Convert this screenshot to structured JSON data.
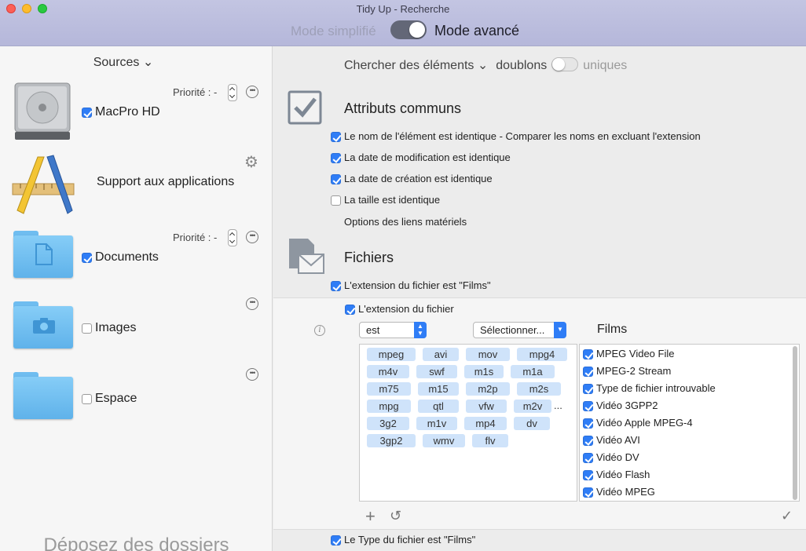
{
  "window": {
    "title": "Tidy Up - Recherche"
  },
  "mode": {
    "simple_label": "Mode simplifié",
    "advanced_label": "Mode avancé"
  },
  "sources": {
    "title": "Sources ⌄",
    "items": [
      {
        "label": "MacPro HD",
        "checked": true,
        "priority_label": "Priorité : -"
      },
      {
        "label": "Support aux applications"
      },
      {
        "label": "Documents",
        "checked": true,
        "priority_label": "Priorité : -"
      },
      {
        "label": "Images",
        "checked": false
      },
      {
        "label": "Espace",
        "checked": false
      }
    ],
    "drop_hint": "Déposez des dossiers"
  },
  "search": {
    "chercher_label": "Chercher des éléments ⌄",
    "doublons_label": "doublons",
    "uniques_label": "uniques"
  },
  "common_attributes": {
    "title": "Attributs communs",
    "options": [
      {
        "label": "Le nom de l'élément est identique - Comparer les noms en excluant l'extension",
        "checked": true
      },
      {
        "label": "La date de modification est identique",
        "checked": true
      },
      {
        "label": "La date de création est identique",
        "checked": true
      },
      {
        "label": "La taille est identique",
        "checked": false
      }
    ],
    "hardlinks_label": "Options des liens matériels"
  },
  "files": {
    "title": "Fichiers",
    "ext_films_label": "L'extension du fichier est \"Films\"",
    "ext_label": "L'extension du fichier",
    "operator_select": "est",
    "select_placeholder": "Sélectionner...",
    "films_header": "Films",
    "type_films_label": "Le Type du fichier est \"Films\""
  },
  "extensions": [
    "mpeg",
    "avi",
    "mov",
    "mpg4",
    "m4v",
    "swf",
    "m1s",
    "m1a",
    "m75",
    "m15",
    "m2p",
    "m2s",
    "mpg",
    "qtl",
    "vfw",
    "m2v",
    "3g2",
    "m1v",
    "mp4",
    "dv",
    "3gp2",
    "wmv",
    "flv"
  ],
  "ext_ellipsis": "...",
  "film_types": [
    "MPEG Video File",
    "MPEG-2 Stream",
    "Type de fichier introuvable",
    "Vidéo 3GPP2",
    "Vidéo Apple MPEG-4",
    "Vidéo AVI",
    "Vidéo DV",
    "Vidéo Flash",
    "Vidéo MPEG"
  ],
  "icons": {
    "gear": "⚙",
    "more": "•••",
    "info": "i",
    "add": "+",
    "reset": "↺",
    "confirm": "✓"
  },
  "colors": {
    "accent": "#2f7df6",
    "titlebar": "#b8badb",
    "token": "#cfe3fa"
  }
}
